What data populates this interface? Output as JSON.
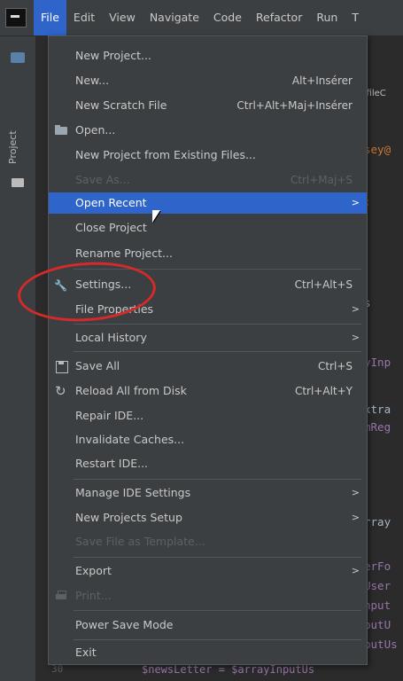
{
  "menubar": {
    "items": [
      {
        "label": "File",
        "active": true
      },
      {
        "label": "Edit"
      },
      {
        "label": "View"
      },
      {
        "label": "Navigate"
      },
      {
        "label": "Code"
      },
      {
        "label": "Refactor"
      },
      {
        "label": "Run"
      },
      {
        "label": "T"
      }
    ]
  },
  "toolstrip": {
    "project_label": "Project"
  },
  "editor": {
    "tab_label": "¦ fileC",
    "lines": [
      {
        "text": "sey@",
        "color": "#cc7832"
      },
      {
        "text": ";",
        "color": "#cc7832"
      },
      {
        "text": "s",
        "color": "#a9b7c6"
      },
      {
        "text": "yInp",
        "color": "#9876aa"
      },
      {
        "text": "xtra",
        "color": "#a9b7c6"
      },
      {
        "text": "mReg",
        "color": "#9876aa"
      },
      {
        "text": "rray",
        "color": "#a9b7c6"
      },
      {
        "text": "erFo",
        "color": "#9876aa"
      },
      {
        "text": "User",
        "color": "#9876aa"
      },
      {
        "text": "nput",
        "color": "#9876aa"
      },
      {
        "text": "putU",
        "color": "#9876aa"
      },
      {
        "text": "putUs",
        "color": "#9876aa"
      }
    ],
    "bottom_line": "$newsLetter = $arrayInputUs",
    "line_number": "30"
  },
  "file_menu": {
    "items": [
      {
        "label": "New Project...",
        "shortcut": ""
      },
      {
        "label": "New...",
        "shortcut": "Alt+Insérer"
      },
      {
        "label": "New Scratch File",
        "shortcut": "Ctrl+Alt+Maj+Insérer"
      },
      {
        "label": "Open...",
        "shortcut": ""
      },
      {
        "label": "New Project from Existing Files...",
        "shortcut": ""
      },
      {
        "label": "Save As...",
        "shortcut": "Ctrl+Maj+S"
      },
      {
        "label": "Open Recent",
        "shortcut": ""
      },
      {
        "label": "Close Project",
        "shortcut": ""
      },
      {
        "label": "Rename Project...",
        "shortcut": ""
      },
      {
        "label": "Settings...",
        "shortcut": "Ctrl+Alt+S"
      },
      {
        "label": "File Properties",
        "shortcut": ""
      },
      {
        "label": "Local History",
        "shortcut": ""
      },
      {
        "label": "Save All",
        "shortcut": "Ctrl+S"
      },
      {
        "label": "Reload All from Disk",
        "shortcut": "Ctrl+Alt+Y"
      },
      {
        "label": "Repair IDE...",
        "shortcut": ""
      },
      {
        "label": "Invalidate Caches...",
        "shortcut": ""
      },
      {
        "label": "Restart IDE...",
        "shortcut": ""
      },
      {
        "label": "Manage IDE Settings",
        "shortcut": ""
      },
      {
        "label": "New Projects Setup",
        "shortcut": ""
      },
      {
        "label": "Save File as Template...",
        "shortcut": ""
      },
      {
        "label": "Export",
        "shortcut": ""
      },
      {
        "label": "Print...",
        "shortcut": ""
      },
      {
        "label": "Power Save Mode",
        "shortcut": ""
      },
      {
        "label": "Exit",
        "shortcut": ""
      }
    ],
    "arrow": ">"
  },
  "icons": {
    "folder": "folder-icon",
    "wrench": "wrench-icon",
    "save": "save-icon",
    "reload": "reload-icon",
    "print": "print-icon"
  },
  "colors": {
    "highlight": "#2f65ca",
    "annotation": "#d42a2a",
    "menu_bg": "#3c3f41",
    "editor_bg": "#2b2b2b"
  }
}
